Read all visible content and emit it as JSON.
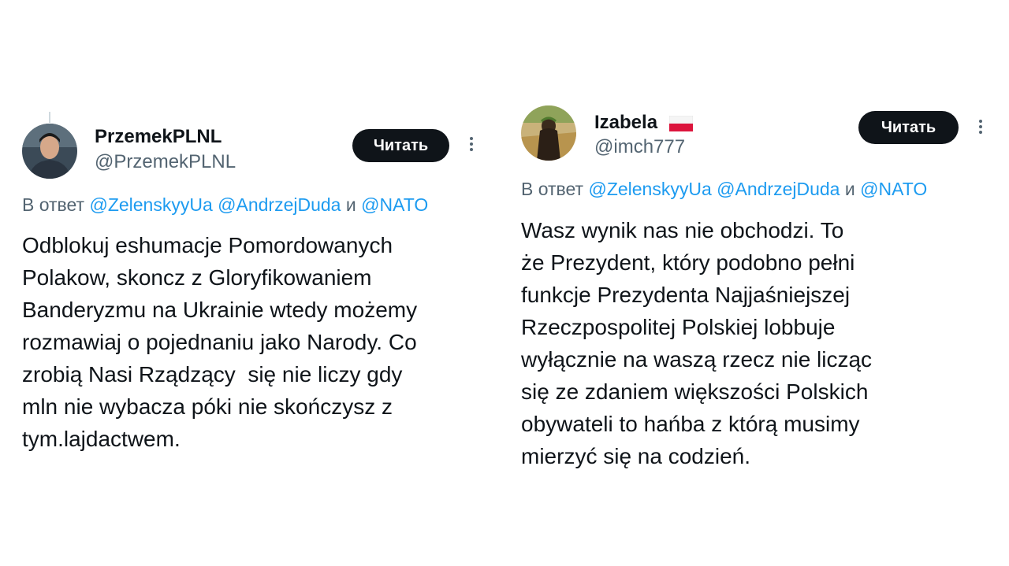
{
  "tweets": [
    {
      "display_name": "PrzemekPLNL",
      "handle": "@PrzemekPLNL",
      "avatar_icon": "user-photo-avatar",
      "follow_label": "Читать",
      "more_icon": "ellipsis-vertical-icon",
      "reply_prefix": "В ответ",
      "mentions": [
        "@ZelenskyyUa",
        "@AndrzejDuda",
        "@NATO"
      ],
      "reply_conjunction": "и",
      "body_lines": [
        "Odblokuj eshumacje Pomordowanych",
        "Polakow, skoncz z Gloryfikowaniem",
        "Banderyzmu na Ukrainie wtedy możemy",
        "rozmawiaj o pojednaniu jako Narody. Co",
        "zrobią Nasi Rządzący  się nie liczy gdy",
        "mln nie wybacza póki nie skończysz z",
        "tym.lajdactwem."
      ]
    },
    {
      "display_name": "Izabela",
      "handle": "@imch777",
      "name_badge": "poland-flag-emoji",
      "avatar_icon": "user-photo-avatar",
      "follow_label": "Читать",
      "more_icon": "ellipsis-vertical-icon",
      "reply_prefix": "В ответ",
      "mentions": [
        "@ZelenskyyUa",
        "@AndrzejDuda",
        "@NATO"
      ],
      "reply_conjunction": "и",
      "body_lines": [
        "Wasz wynik nas nie obchodzi. To",
        "że Prezydent, który podobno pełni",
        "funkcje Prezydenta Najjaśniejszej",
        "Rzeczpospolitej Polskiej lobbuje",
        "wyłącznie na waszą rzecz nie licząc",
        "się ze zdaniem większości Polskich",
        "obywateli to hańba z którą musimy",
        "mierzyć się na codzień."
      ]
    }
  ],
  "colors": {
    "text": "#0f1419",
    "secondary": "#536471",
    "link": "#1d9bf0",
    "button": "#0f1419",
    "divider": "#cfd9de"
  }
}
